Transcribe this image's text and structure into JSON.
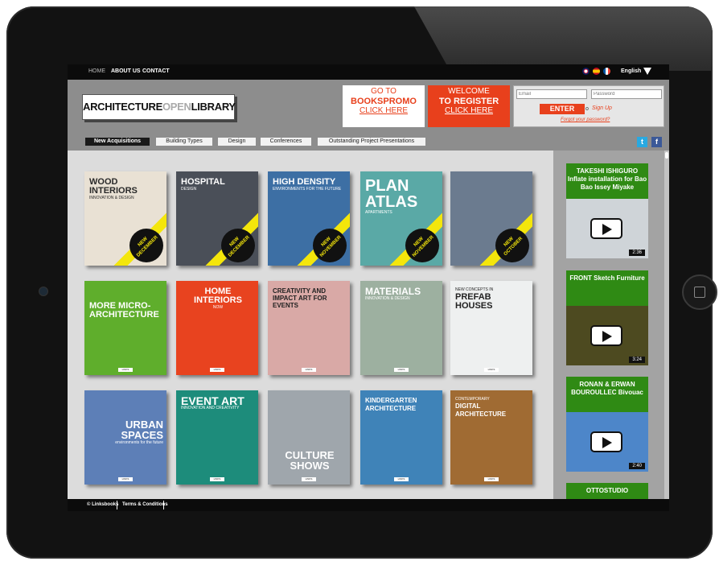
{
  "topnav": {
    "home": "HOME",
    "about": "ABOUT US",
    "contact": "CONTACT",
    "language": "English"
  },
  "logo": {
    "part1": "ARCHITECTURE",
    "part2": "OPEN",
    "part3": "LIBRARY"
  },
  "promo_books": {
    "line1": "GO TO",
    "line2": "BOOKSPROMO",
    "link": "CLICK HERE"
  },
  "promo_register": {
    "line1": "WELCOME",
    "line2": "TO REGISTER",
    "link": "CLICK HERE"
  },
  "login": {
    "email_placeholder": "Email",
    "password_placeholder": "Password",
    "enter_label": "ENTER",
    "or": "o",
    "signup": "Sign Up",
    "forgot": "Forgot your password?"
  },
  "categories": [
    "New Acquisitions",
    "Building Types",
    "Design",
    "Conferences",
    "Outstanding Project Presentations"
  ],
  "social": {
    "twitter": "twitter-icon",
    "facebook": "facebook-icon"
  },
  "books": [
    {
      "title": "WOOD INTERIORS",
      "subtitle": "INNOVATION & DESIGN",
      "badge": "NEW",
      "month": "DECEMBER",
      "bg": "#e9e1d4",
      "fg": "#2a2a2a"
    },
    {
      "title": "HOSPITAL",
      "subtitle": "DESIGN",
      "badge": "NEW",
      "month": "DECEMBER",
      "bg": "#4a4f58",
      "fg": "#ffffff"
    },
    {
      "title": "HIGH DENSITY",
      "subtitle": "ENVIRONMENTS FOR THE FUTURE",
      "badge": "NEW",
      "month": "NOVEMBER",
      "bg": "#3d6fa4",
      "fg": "#ffffff"
    },
    {
      "title": "PLAN ATLAS",
      "subtitle": "APARTMENTS",
      "badge": "NEW",
      "month": "NOVEMBER",
      "bg": "#5aa9a6",
      "fg": "#ffffff"
    },
    {
      "title": "",
      "subtitle": "",
      "badge": "NEW",
      "month": "OCTOBER",
      "bg": "#6b7b8f",
      "fg": "#ffffff"
    },
    {
      "title": "MORE MICRO- ARCHITECTURE",
      "subtitle": "",
      "badge": "",
      "month": "",
      "bg": "#5fae2c",
      "fg": "#ffffff"
    },
    {
      "title": "HOME INTERIORS",
      "subtitle": "NOW",
      "badge": "",
      "month": "",
      "bg": "#e8431f",
      "fg": "#ffffff"
    },
    {
      "title": "CREATIVITY AND IMPACT ART FOR EVENTS",
      "subtitle": "",
      "badge": "",
      "month": "",
      "bg": "#d9a9a6",
      "fg": "#222222"
    },
    {
      "title": "MATERIALS",
      "subtitle": "INNOVATION & DESIGN",
      "badge": "",
      "month": "",
      "bg": "#9db0a0",
      "fg": "#ffffff"
    },
    {
      "title": "PREFAB HOUSES",
      "subtitle": "NEW CONCEPTS IN",
      "badge": "",
      "month": "",
      "bg": "#eef0f0",
      "fg": "#222222"
    },
    {
      "title": "URBAN SPACES",
      "subtitle": "environments for the future",
      "badge": "",
      "month": "",
      "bg": "#5d7fb7",
      "fg": "#ffffff"
    },
    {
      "title": "EVENT ART",
      "subtitle": "INNOVATION AND CREATIVITY",
      "badge": "",
      "month": "",
      "bg": "#1d8c7b",
      "fg": "#ffffff"
    },
    {
      "title": "CULTURE SHOWS",
      "subtitle": "",
      "badge": "",
      "month": "",
      "bg": "#9fa6ac",
      "fg": "#ffffff"
    },
    {
      "title": "KINDERGARTEN ARCHITECTURE",
      "subtitle": "",
      "badge": "",
      "month": "",
      "bg": "#3f83b8",
      "fg": "#ffffff"
    },
    {
      "title": "DIGITAL ARCHITECTURE",
      "subtitle": "CONTEMPORARY",
      "badge": "",
      "month": "",
      "bg": "#a06b33",
      "fg": "#ffffff"
    }
  ],
  "videos": [
    {
      "title": "TAKESHI ISHIGURO Inflate installation for Bao Bao Issey Miyake",
      "duration": "2:36",
      "thumb": "#cfd4d8"
    },
    {
      "title": "FRONT Sketch Furniture",
      "duration": "3:24",
      "thumb": "#4d4a20"
    },
    {
      "title": "RONAN & ERWAN BOUROULLEC Bivouac",
      "duration": "2:40",
      "thumb": "#4d86c9"
    },
    {
      "title": "OTTOSTUDIO",
      "duration": "",
      "thumb": "#2f8a14"
    }
  ],
  "footer": {
    "copyright": "© Linksbooks",
    "terms": "Terms & Conditions"
  }
}
